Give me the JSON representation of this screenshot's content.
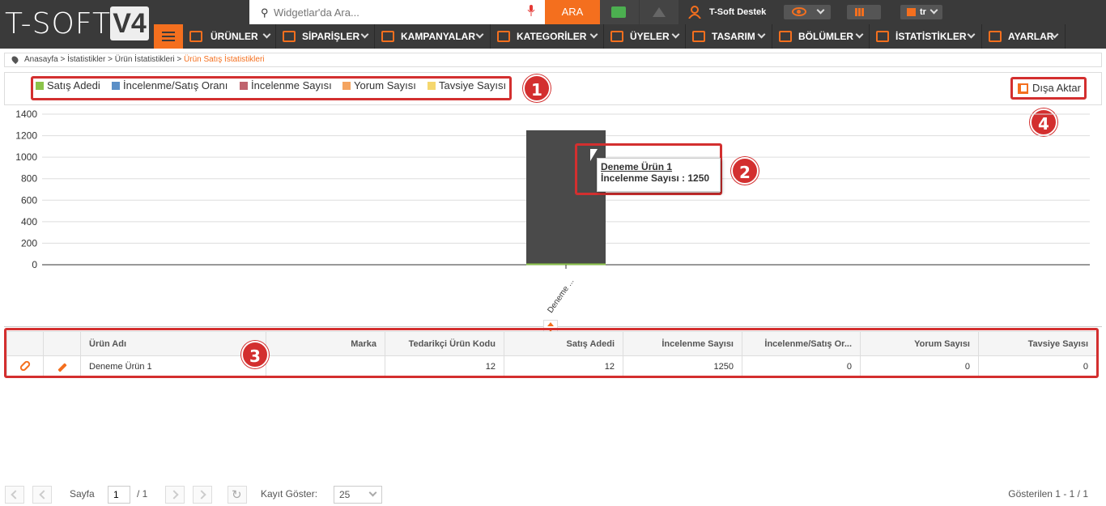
{
  "logo": {
    "text": "T-SOFT",
    "version": "V4"
  },
  "search": {
    "placeholder": "Widgetlar'da Ara...",
    "button": "ARA"
  },
  "user": {
    "name": "T-Soft Destek"
  },
  "lang": {
    "code": "tr"
  },
  "nav": [
    {
      "label": "ÜRÜNLER"
    },
    {
      "label": "SİPARİŞLER"
    },
    {
      "label": "KAMPANYALAR"
    },
    {
      "label": "KATEGORİLER"
    },
    {
      "label": "ÜYELER"
    },
    {
      "label": "TASARIM"
    },
    {
      "label": "BÖLÜMLER"
    },
    {
      "label": "İSTATİSTİKLER"
    },
    {
      "label": "AYARLAR"
    }
  ],
  "breadcrumb": {
    "path": "Anasayfa > İstatistikler > Ürün İstatistikleri > ",
    "current": "Ürün Satış İstatistikleri"
  },
  "legend": [
    {
      "label": "Satış Adedi",
      "color": "#8bc34a"
    },
    {
      "label": "İncelenme/Satış Oranı",
      "color": "#5b8fc7"
    },
    {
      "label": "İncelenme Sayısı",
      "color": "#c0646e"
    },
    {
      "label": "Yorum Sayısı",
      "color": "#f4a460"
    },
    {
      "label": "Tavsiye Sayısı",
      "color": "#f5d76e"
    }
  ],
  "export": {
    "label": "Dışa Aktar"
  },
  "badges": {
    "b1": "1",
    "b2": "2",
    "b3": "3",
    "b4": "4"
  },
  "chart_data": {
    "type": "bar",
    "categories": [
      "Deneme ..."
    ],
    "series": [
      {
        "name": "İncelenme Sayısı",
        "values": [
          1250
        ],
        "color": "#4a4a4a"
      },
      {
        "name": "Satış Adedi",
        "values": [
          12
        ],
        "color": "#8bc34a"
      }
    ],
    "ylim": [
      0,
      1400
    ],
    "yticks": [
      0,
      200,
      400,
      600,
      800,
      1000,
      1200,
      1400
    ],
    "grid": true
  },
  "tooltip": {
    "title": "Deneme Ürün 1",
    "line": "İncelenme Sayısı : 1250"
  },
  "table": {
    "headers": [
      "",
      "",
      "Ürün Adı",
      "Marka",
      "Tedarikçi Ürün Kodu",
      "Satış Adedi",
      "İncelenme Sayısı",
      "İncelenme/Satış Or...",
      "Yorum Sayısı",
      "Tavsiye Sayısı"
    ],
    "rows": [
      {
        "name": "Deneme Ürün 1",
        "brand": "",
        "supplier_code": "12",
        "sales": "12",
        "views": "1250",
        "ratio": "0",
        "comments": "0",
        "recommend": "0"
      }
    ]
  },
  "pager": {
    "page_label": "Sayfa",
    "page": "1",
    "of": "/ 1",
    "show_label": "Kayıt Göster:",
    "page_size": "25",
    "status": "Gösterilen 1 - 1 / 1"
  }
}
